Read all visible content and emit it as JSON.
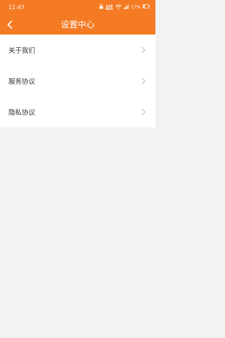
{
  "status_bar": {
    "time": "11:47",
    "speed": "4.00\nKB/S",
    "battery": "17%"
  },
  "header": {
    "title": "设置中心",
    "back_icon": "chevron-left-icon"
  },
  "menu": {
    "items": [
      {
        "label": "关于我们"
      },
      {
        "label": "服务协议"
      },
      {
        "label": "隐私协议"
      }
    ]
  },
  "colors": {
    "accent": "#f47b23",
    "background": "#f2f2f2",
    "text": "#333333",
    "chevron": "#b8b8b8"
  }
}
